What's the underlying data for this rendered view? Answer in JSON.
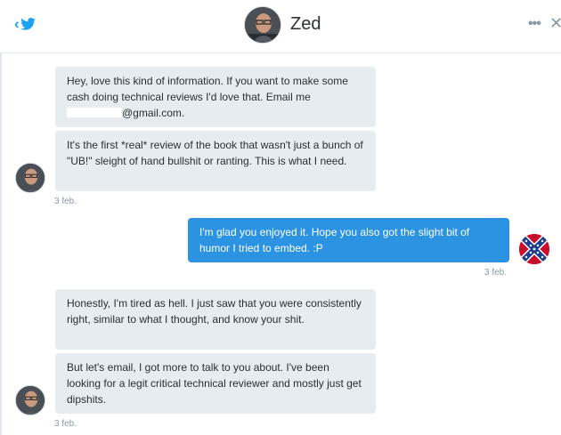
{
  "header": {
    "name": "Zed",
    "back_icon": "chevron-left-icon",
    "logo_icon": "twitter-bird-icon",
    "more_icon": "more-dots-icon",
    "close_icon": "close-icon"
  },
  "messages": [
    {
      "from": "Zed",
      "text_parts": [
        "Hey, love this kind of information. If you want to make some cash doing technical reviews I'd love that.  Email me ",
        "@gmail.com."
      ]
    },
    {
      "from": "Zed",
      "text": "It's the first *real* review of the book that wasn't just a bunch of \"UB!\" sleight of hand bullshit or ranting.  This is what I need."
    },
    {
      "from": "me",
      "text": "I'm glad you enjoyed it. Hope you also got the slight bit of humor I tried to embed. :P"
    },
    {
      "from": "Zed",
      "text": "Honestly, I'm tired as hell.  I just saw that you were consistently right, similar to what I thought, and know your shit."
    },
    {
      "from": "Zed",
      "text": "But let's email, I got more to talk to you about.  I've been looking for a legit critical technical reviewer and mostly just get dipshits."
    }
  ],
  "timestamps": [
    "3 feb.",
    "3 feb.",
    "3 feb."
  ],
  "colors": {
    "accent": "#1da1f2",
    "outgoing_bubble": "#2b93e2",
    "incoming_bubble": "#e6ecf0",
    "muted": "#8899a6"
  }
}
